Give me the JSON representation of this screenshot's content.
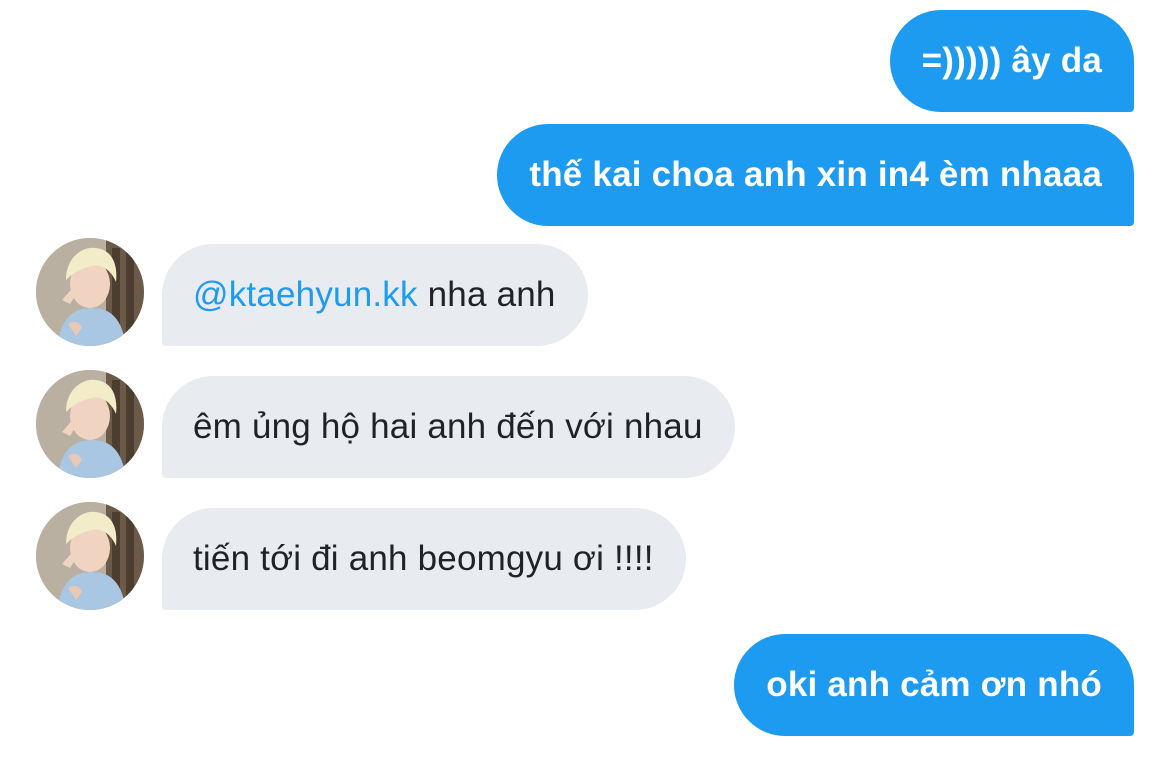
{
  "conversation": {
    "messages": [
      {
        "direction": "out",
        "text": "=))))) ây da"
      },
      {
        "direction": "out",
        "text": "thế kai choa anh xin in4 èm nhaaa"
      },
      {
        "direction": "in",
        "mention": "@ktaehyun.kk",
        "text": " nha anh"
      },
      {
        "direction": "in",
        "text": "êm ủng hộ hai anh đến với nhau"
      },
      {
        "direction": "in",
        "text": "tiến tới đi anh beomgyu ơi !!!!"
      },
      {
        "direction": "out",
        "text": "oki anh cảm ơn nhó"
      }
    ]
  },
  "colors": {
    "outgoing_bubble": "#1d9bf0",
    "incoming_bubble": "#e8ecf0",
    "mention": "#1d9bf0"
  },
  "icons": {
    "avatar": "user-avatar-photo"
  }
}
